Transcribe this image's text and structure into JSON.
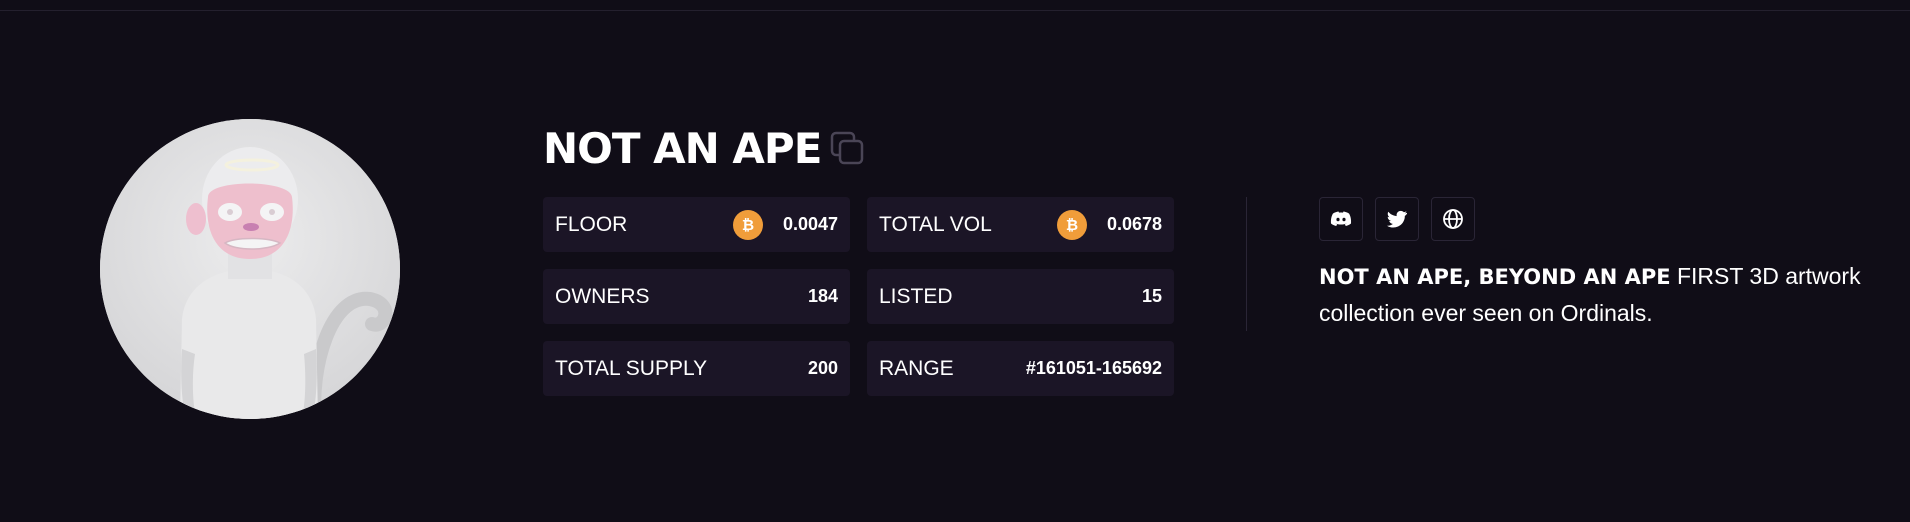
{
  "collection": {
    "name": "NOT AN APE",
    "description_bold": "NOT AN APE, BEYOND AN APE",
    "description_rest": " FIRST 3D artwork collection ever seen on Ordinals."
  },
  "stats": [
    {
      "label": "FLOOR",
      "value": "0.0047",
      "icon": "bitcoin-icon"
    },
    {
      "label": "TOTAL VOL",
      "value": "0.0678",
      "icon": "bitcoin-icon"
    },
    {
      "label": "OWNERS",
      "value": "184"
    },
    {
      "label": "LISTED",
      "value": "15"
    },
    {
      "label": "TOTAL SUPPLY",
      "value": "200"
    },
    {
      "label": "RANGE",
      "value": "#161051-165692"
    }
  ],
  "socials": [
    "discord-icon",
    "twitter-icon",
    "globe-icon"
  ],
  "colors": {
    "background": "#100d17",
    "card": "#1b1526",
    "bitcoin": "#f09d3a"
  }
}
